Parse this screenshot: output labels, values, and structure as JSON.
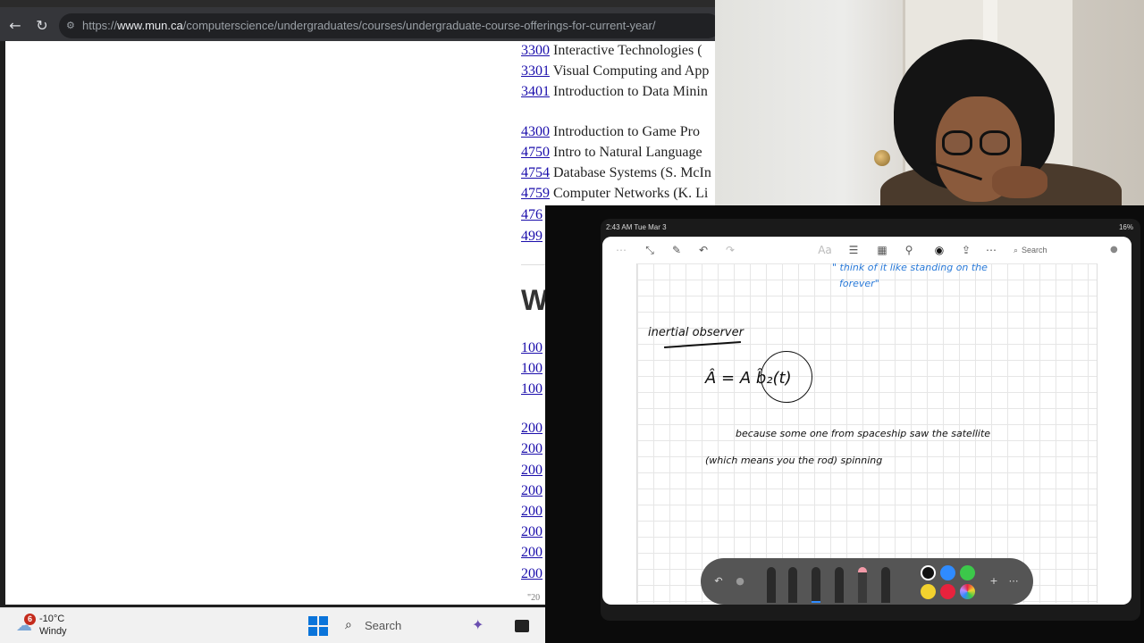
{
  "browser": {
    "url_scheme": "https://",
    "url_host": "www.mun.ca",
    "url_path": "/computerscience/undergraduates/courses/undergraduate-course-offerings-for-current-year/",
    "courses": [
      {
        "code": "3300",
        "title": "Interactive Technologies ("
      },
      {
        "code": "3301",
        "title": "Visual Computing and App"
      },
      {
        "code": "3401",
        "title": "Introduction to Data Minin"
      },
      {
        "code": "4300",
        "title": "Introduction to Game Pro"
      },
      {
        "code": "4750",
        "title": "Intro to Natural Language"
      },
      {
        "code": "4754",
        "title": "Database Systems (S. McIn"
      },
      {
        "code": "4759",
        "title": "Computer Networks (K. Li"
      },
      {
        "code": "476",
        "title": ""
      },
      {
        "code": "499",
        "title": ""
      }
    ],
    "heading_fragment": "W",
    "lower_codes": [
      "100",
      "100",
      "100",
      "200",
      "200",
      "200",
      "200",
      "200",
      "200",
      "200",
      "200"
    ],
    "footer_fragment": "\"20"
  },
  "taskbar": {
    "weather_badge": "6",
    "weather_temp": "-10°C",
    "weather_cond": "Windy",
    "search_label": "Search"
  },
  "ipad": {
    "status_time": "2:43 AM  Tue Mar 3",
    "status_battery": "16%",
    "search_label": "Search",
    "toolbar_icons": [
      "more-dots-icon",
      "collapse-icon",
      "compose-icon",
      "undo-icon",
      "redo-icon",
      "text-format-icon",
      "checklist-icon",
      "table-icon",
      "attachment-icon",
      "markup-icon",
      "share-icon",
      "more-icon",
      "search-icon",
      "microphone-icon"
    ]
  },
  "handwriting": {
    "line1": "\" think of it like standing on the",
    "line2": "forever\"",
    "heading": "inertial observer",
    "equation": "Â = A b̂₂(t)",
    "line3": "because   some one   from  spaceship   saw  the  satellite",
    "line4": "(which means  you  the  rod)   spinning"
  },
  "palette": {
    "swatches": [
      "#111111",
      "#2f8bff",
      "#3cc84a",
      "#f2d22e",
      "#e8223d",
      "#b98cff"
    ]
  }
}
